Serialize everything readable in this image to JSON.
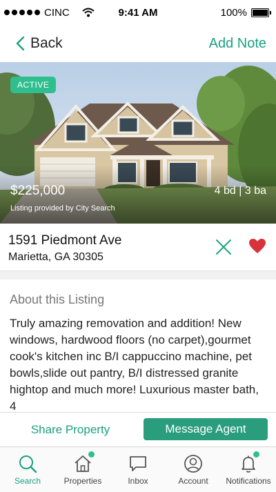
{
  "status_bar": {
    "carrier": "CINC",
    "time": "9:41 AM",
    "battery": "100%",
    "icons": [
      "signal-dots-icon",
      "wifi-icon",
      "battery-icon"
    ]
  },
  "nav": {
    "back_label": "Back",
    "add_note_label": "Add Note",
    "accent_color": "#1aa17f"
  },
  "listing": {
    "status_badge": "ACTIVE",
    "price": "$225,000",
    "provided_by": "Listing provided by City Search",
    "beds_baths": "4 bd | 3 ba",
    "street": "1591 Piedmont Ave",
    "city_state_zip": "Marietta, GA 30305",
    "favorited": true
  },
  "about": {
    "title": "About this Listing",
    "description": "Truly amazing removation and addition! New windows, hardwood floors (no carpet),gourmet cook's kitchen inc B/I cappuccino machine, pet bowls,slide out pantry, B/I distressed granite hightop and much more! Luxurious master bath, 4"
  },
  "actions": {
    "share_label": "Share Property",
    "message_label": "Message Agent"
  },
  "tabs": [
    {
      "label": "Search",
      "icon": "search-icon",
      "active": true,
      "badge": false
    },
    {
      "label": "Properties",
      "icon": "house-icon",
      "active": false,
      "badge": true
    },
    {
      "label": "Inbox",
      "icon": "chat-icon",
      "active": false,
      "badge": false
    },
    {
      "label": "Account",
      "icon": "user-icon",
      "active": false,
      "badge": false
    },
    {
      "label": "Notifications",
      "icon": "bell-icon",
      "active": false,
      "badge": true
    }
  ]
}
